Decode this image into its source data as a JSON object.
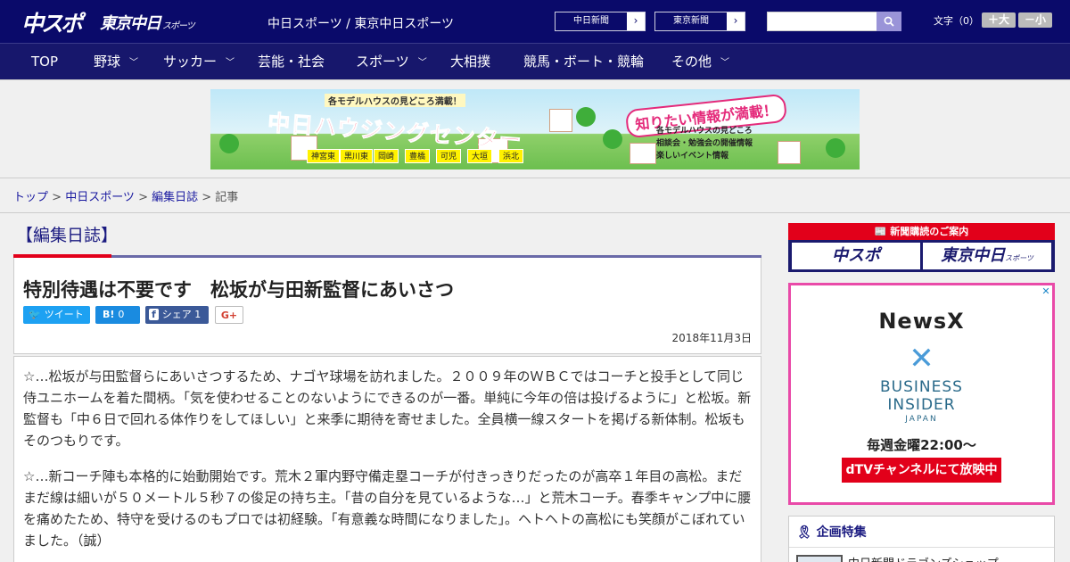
{
  "header": {
    "logo_chusupo": "中スポ",
    "logo_tokyo": "東京中日",
    "logo_tokyo_suffix": "スポーツ",
    "site_title": "中日スポーツ / 東京中日スポーツ",
    "paper_links": [
      "中日新聞",
      "東京新聞"
    ],
    "search": {
      "value": "",
      "placeholder": ""
    },
    "font_size_label": "文字（0）",
    "font_plus": "＋大",
    "font_minus": "－小"
  },
  "nav": {
    "items": [
      {
        "label": "TOP"
      },
      {
        "label": "野球"
      },
      {
        "label": "サッカー"
      },
      {
        "label": "芸能・社会"
      },
      {
        "label": "スポーツ"
      },
      {
        "label": "大相撲"
      },
      {
        "label": "競馬・ボート・競輪"
      },
      {
        "label": "その他"
      }
    ]
  },
  "banner": {
    "sub": "各モデルハウスの見どころ満載！",
    "main": "中日ハウジングセンター",
    "badge": "知りたい情報が満載！",
    "info": [
      "各モデルハウスの見どころ",
      "相談会・勉強会の開催情報",
      "楽しいイベント情報"
    ],
    "cities": [
      "神宮東",
      "黒川東",
      "岡崎",
      "豊橋",
      "可児",
      "大垣",
      "浜北"
    ]
  },
  "breadcrumb": {
    "items": [
      "トップ",
      "中日スポーツ",
      "編集日誌",
      "記事"
    ]
  },
  "category": {
    "title": "【編集日誌】"
  },
  "article": {
    "title": "特別待遇は不要です　松坂が与田新監督にあいさつ",
    "share": {
      "twitter": "ツイート",
      "hatena_count": "0",
      "facebook": "シェア",
      "facebook_count": "1",
      "googleplus": "G+"
    },
    "date": "2018年11月3日",
    "paragraphs": [
      "☆…松坂が与田監督らにあいさつするため、ナゴヤ球場を訪れました。２００９年のＷＢＣではコーチと投手として同じ侍ユニホームを着た間柄。「気を使わせることのないようにできるのが一番。単純に今年の倍は投げるように」と松坂。新監督も「中６日で回れる体作りをしてほしい」と来季に期待を寄せました。全員横一線スタートを掲げる新体制。松坂もそのつもりです。",
      "☆…新コーチ陣も本格的に始動開始です。荒木２軍内野守備走塁コーチが付きっきりだったのが高卒１年目の高松。まだまだ線は細いが５０メートル５秒７の俊足の持ち主。「昔の自分を見ているような…」と荒木コーチ。春季キャンプ中に腰を痛めたため、特守を受けるのもプロでは初経験。「有意義な時間になりました」。ヘトヘトの高松にも笑顔がこぼれていました。（誠）"
    ]
  },
  "sidebar": {
    "subscribe_head": "新聞購読のご案内",
    "subscribe_chusupo": "中スポ",
    "subscribe_tokyo": "東京中日",
    "subscribe_tokyo_suffix": "スポーツ",
    "ad": {
      "newsx": "NewsX",
      "x": "✕",
      "bi_line1": "BUSINESS",
      "bi_line2": "INSIDER",
      "jp": "JAPAN",
      "schedule": "毎週金曜22:00〜",
      "cta": "dTVチャンネルにて放映中",
      "close": "✕"
    },
    "features_title": "企画特集",
    "features_item": "中日新聞ドラゴンズショップ"
  }
}
